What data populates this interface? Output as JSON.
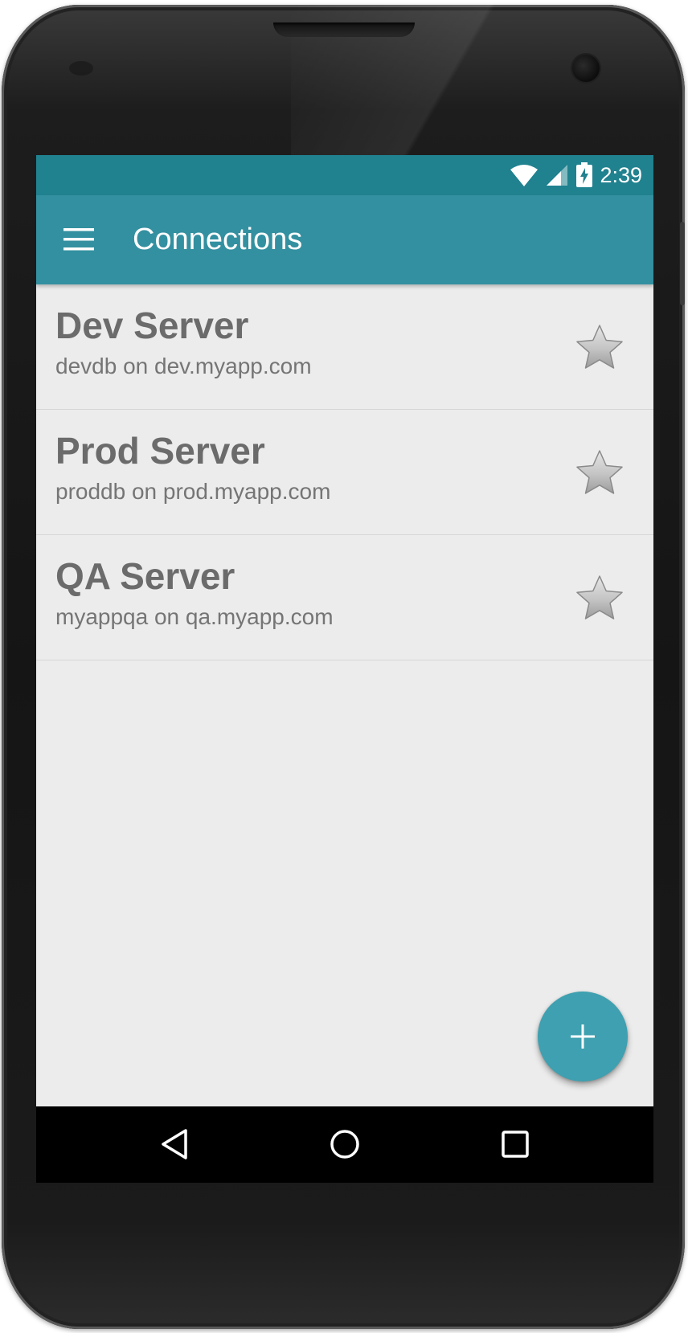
{
  "status_bar": {
    "time": "2:39",
    "icons": [
      "wifi-icon",
      "cell-signal-icon",
      "battery-charging-icon"
    ]
  },
  "app_bar": {
    "title": "Connections",
    "menu_icon": "hamburger-menu-icon"
  },
  "connections": [
    {
      "name": "Dev Server",
      "detail": "devdb on dev.myapp.com",
      "favorite_icon": "star-icon"
    },
    {
      "name": "Prod Server",
      "detail": "proddb on prod.myapp.com",
      "favorite_icon": "star-icon"
    },
    {
      "name": "QA Server",
      "detail": "myappqa on qa.myapp.com",
      "favorite_icon": "star-icon"
    }
  ],
  "fab": {
    "icon": "plus-icon"
  },
  "nav_bar": {
    "icons": [
      "back-icon",
      "home-icon",
      "recents-icon"
    ]
  },
  "colors": {
    "status_bar": "#20818f",
    "app_bar": "#3390a0",
    "fab": "#3ea0b0",
    "list_background": "#ececec",
    "title_text": "#6b6b6b",
    "subtitle_text": "#757575"
  }
}
